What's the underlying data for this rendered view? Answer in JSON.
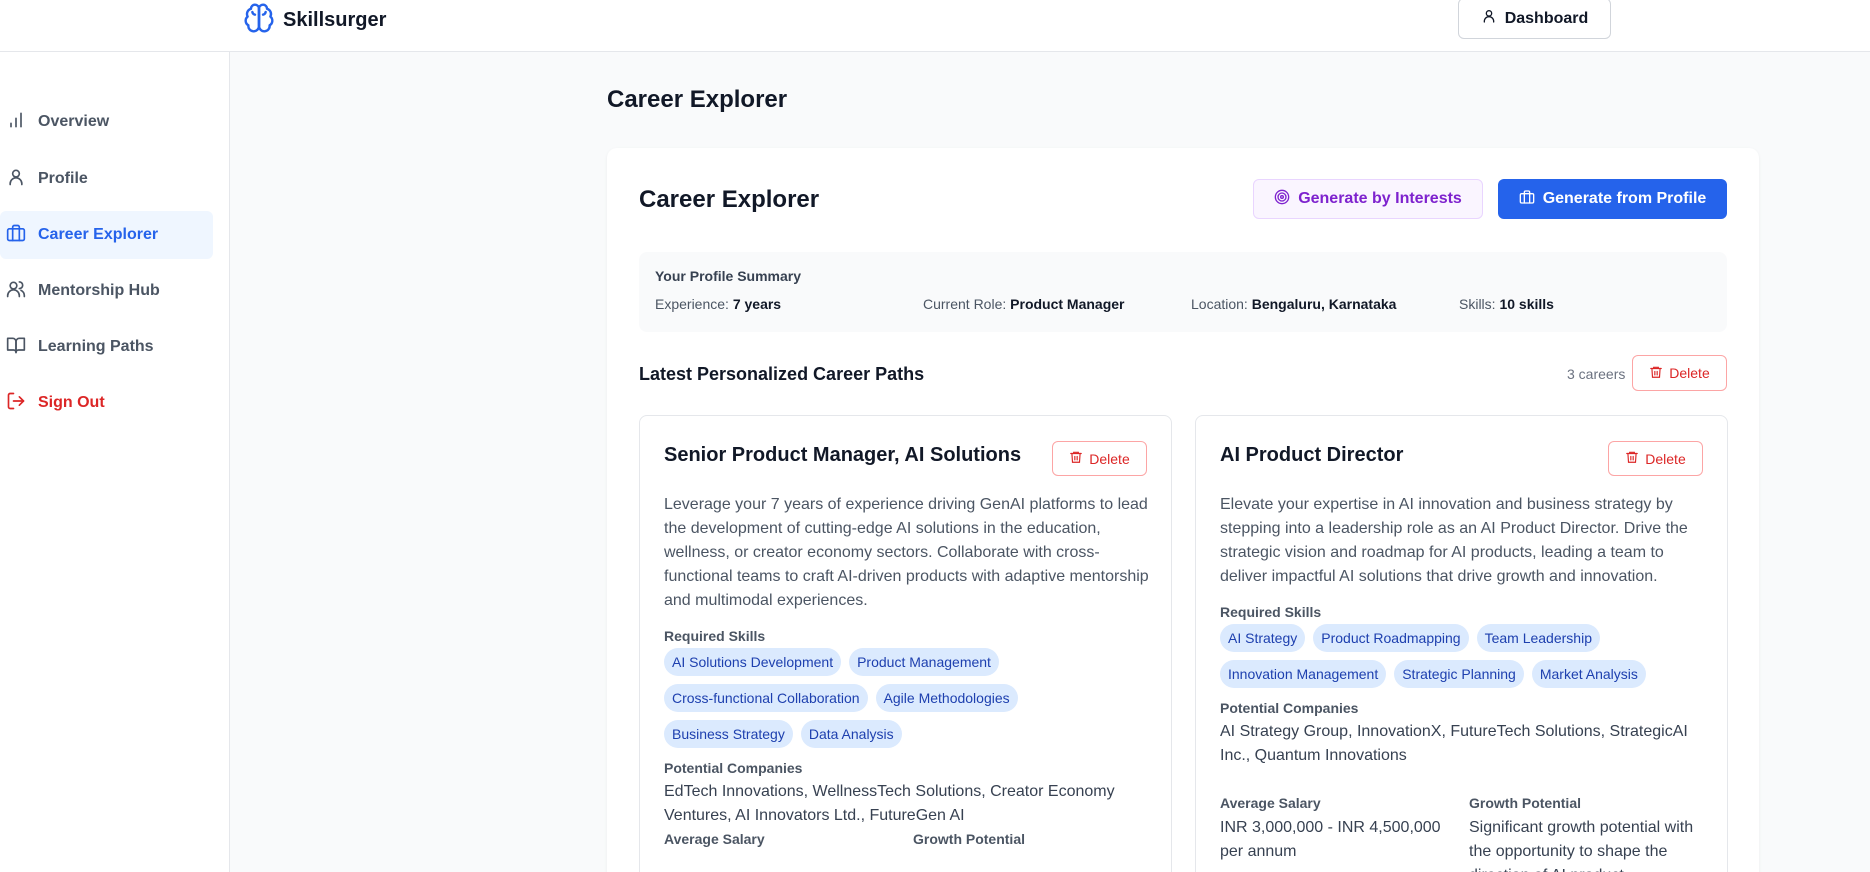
{
  "app": {
    "name": "Skillsurger"
  },
  "header": {
    "dashboard_label": "Dashboard"
  },
  "sidebar": {
    "items": [
      {
        "label": "Overview",
        "icon": "bar-chart-icon"
      },
      {
        "label": "Profile",
        "icon": "user-icon"
      },
      {
        "label": "Career Explorer",
        "icon": "briefcase-icon",
        "active": true
      },
      {
        "label": "Mentorship Hub",
        "icon": "users-icon"
      },
      {
        "label": "Learning Paths",
        "icon": "book-open-icon"
      },
      {
        "label": "Sign Out",
        "icon": "log-out-icon"
      }
    ]
  },
  "page": {
    "title": "Career Explorer"
  },
  "explorer": {
    "title": "Career Explorer",
    "generate_interests_label": "Generate by Interests",
    "generate_profile_label": "Generate from Profile"
  },
  "summary": {
    "title": "Your Profile Summary",
    "experience_label": "Experience:",
    "experience_value": "7 years",
    "role_label": "Current Role:",
    "role_value": "Product Manager",
    "location_label": "Location:",
    "location_value": "Bengaluru, Karnataka",
    "skills_label": "Skills:",
    "skills_value": "10 skills"
  },
  "paths": {
    "title": "Latest Personalized Career Paths",
    "count": "3 careers",
    "delete_label": "Delete",
    "labels": {
      "required_skills": "Required Skills",
      "potential_companies": "Potential Companies",
      "average_salary": "Average Salary",
      "growth_potential": "Growth Potential"
    },
    "cards": [
      {
        "title": "Senior Product Manager, AI Solutions",
        "description": "Leverage your 7 years of experience driving GenAI platforms to lead the development of cutting-edge AI solutions in the education, wellness, or creator economy sectors. Collaborate with cross-functional teams to craft AI-driven products with adaptive mentorship and multimodal experiences.",
        "skills": [
          "AI Solutions Development",
          "Product Management",
          "Cross-functional Collaboration",
          "Agile Methodologies",
          "Business Strategy",
          "Data Analysis"
        ],
        "companies": "EdTech Innovations, WellnessTech Solutions, Creator Economy Ventures, AI Innovators Ltd., FutureGen AI",
        "salary": "",
        "growth": ""
      },
      {
        "title": "AI Product Director",
        "description": "Elevate your expertise in AI innovation and business strategy by stepping into a leadership role as an AI Product Director. Drive the strategic vision and roadmap for AI products, leading a team to deliver impactful AI solutions that drive growth and innovation.",
        "skills": [
          "AI Strategy",
          "Product Roadmapping",
          "Team Leadership",
          "Innovation Management",
          "Strategic Planning",
          "Market Analysis"
        ],
        "companies": "AI Strategy Group, InnovationX, FutureTech Solutions, StrategicAI Inc., Quantum Innovations",
        "salary": "INR 3,000,000 - INR 4,500,000 per annum",
        "growth": "Significant growth potential with the opportunity to shape the direction of AI product"
      }
    ]
  },
  "colors": {
    "primary": "#2563eb",
    "danger": "#dc2626",
    "purple": "#7e22ce",
    "chip_bg": "#dbeafe"
  }
}
